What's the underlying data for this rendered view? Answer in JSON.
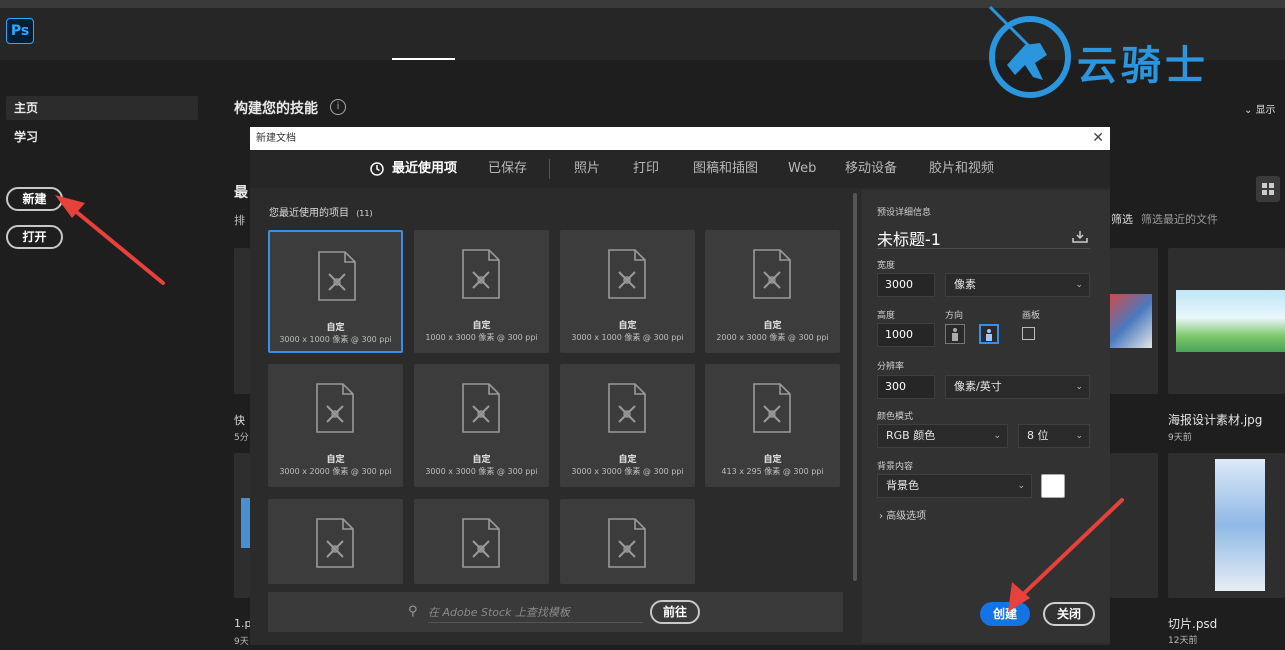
{
  "app": {
    "logo": "Ps"
  },
  "watermark": {
    "text": "云骑士"
  },
  "sidebar": {
    "items": [
      {
        "label": "主页"
      },
      {
        "label": "学习"
      }
    ],
    "new_button": "新建",
    "open_button": "打开"
  },
  "home": {
    "heading": "构建您的技能",
    "recent_partial": "最",
    "sort_partial": "排",
    "show_partial": "显示",
    "filter_label": "筛选",
    "filter_placeholder": "筛选最近的文件",
    "left_files": [
      {
        "name": "快",
        "time": "5分"
      },
      {
        "name": "1.p",
        "time": "9天"
      }
    ],
    "right_files": [
      {
        "name": "海报设计素材.jpg",
        "time": "9天前"
      },
      {
        "name": "切片.psd",
        "time": "12天前"
      }
    ]
  },
  "dialog": {
    "title": "新建文档",
    "tabs": [
      "最近使用项",
      "已保存",
      "照片",
      "打印",
      "图稿和插图",
      "Web",
      "移动设备",
      "胶片和视频"
    ],
    "active_tab": 0,
    "recent_label": "您最近使用的项目",
    "recent_count": "(11)",
    "presets": [
      {
        "name": "自定",
        "size": "3000 x 1000 像素 @ 300 ppi",
        "selected": true
      },
      {
        "name": "自定",
        "size": "1000 x 3000 像素 @ 300 ppi"
      },
      {
        "name": "自定",
        "size": "3000 x 1000 像素 @ 300 ppi"
      },
      {
        "name": "自定",
        "size": "2000 x 3000 像素 @ 300 ppi"
      },
      {
        "name": "自定",
        "size": "3000 x 2000 像素 @ 300 ppi"
      },
      {
        "name": "自定",
        "size": "3000 x 3000 像素 @ 300 ppi"
      },
      {
        "name": "自定",
        "size": "3000 x 3000 像素 @ 300 ppi"
      },
      {
        "name": "自定",
        "size": "413 x 295 像素 @ 300 ppi"
      },
      {
        "name": "",
        "size": ""
      },
      {
        "name": "",
        "size": ""
      },
      {
        "name": "",
        "size": ""
      }
    ],
    "stock_placeholder": "在 Adobe Stock 上查找模板",
    "stock_button": "前往",
    "details": {
      "section_label": "预设详细信息",
      "doc_title": "未标题-1",
      "width_label": "宽度",
      "width_value": "3000",
      "width_unit": "像素",
      "height_label": "高度",
      "height_value": "1000",
      "orientation_label": "方向",
      "artboard_label": "画板",
      "resolution_label": "分辨率",
      "resolution_value": "300",
      "resolution_unit": "像素/英寸",
      "color_mode_label": "颜色模式",
      "color_mode": "RGB 颜色",
      "bit_depth": "8 位",
      "background_label": "背景内容",
      "background_value": "背景色",
      "background_color": "#ffffff",
      "advanced": "高级选项"
    },
    "create_button": "创建",
    "close_button": "关闭"
  },
  "colors": {
    "accent": "#1473e6",
    "annotation_arrow": "#e8413c",
    "watermark": "#2b95de"
  }
}
